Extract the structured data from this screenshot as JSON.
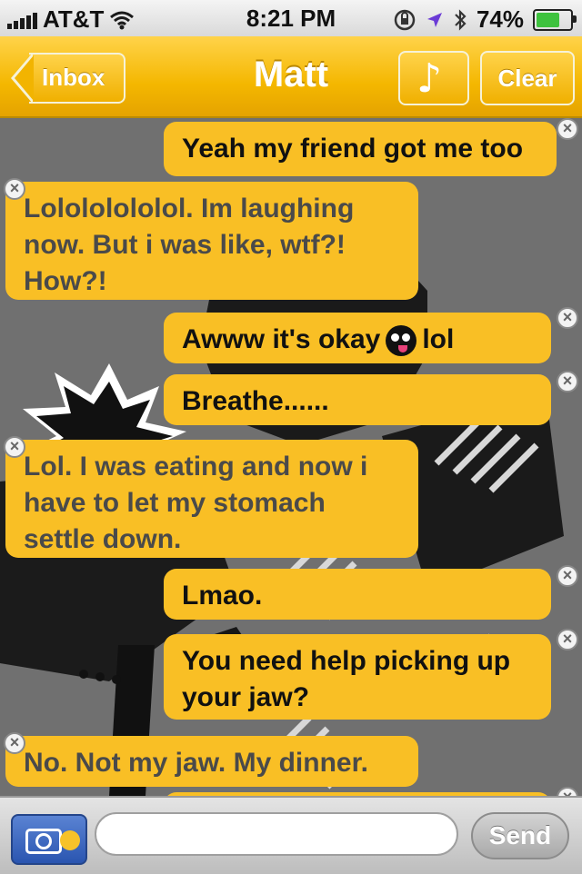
{
  "status": {
    "carrier": "AT&T",
    "time": "8:21 PM",
    "battery": "74%",
    "battery_level": 0.74
  },
  "nav": {
    "back_label": "Inbox",
    "title": "Matt",
    "music_icon": "music-note-icon",
    "clear_label": "Clear"
  },
  "messages": [
    {
      "dir": "out",
      "text": "Yeah my friend got me too"
    },
    {
      "dir": "in",
      "text": "Lolololololol. Im laughing now. But i was like, wtf?! How?!"
    },
    {
      "dir": "out",
      "text_before": "Awww it's okay",
      "emoji": "bomb-face-emoji",
      "text_after": "lol"
    },
    {
      "dir": "out",
      "text": "Breathe......"
    },
    {
      "dir": "in",
      "text": "Lol. I was eating and now i have to let my stomach settle down."
    },
    {
      "dir": "out",
      "text": "Lmao."
    },
    {
      "dir": "out",
      "text": "You need help picking up your jaw?"
    },
    {
      "dir": "in",
      "text": "No. Not my jaw. My dinner."
    }
  ],
  "input": {
    "placeholder": "",
    "send_label": "Send",
    "camera_icon": "camera-icon"
  },
  "colors": {
    "accent": "#f9bf25",
    "navbar": "#f4b700",
    "incoming_text": "#4a4a4a",
    "outgoing_text": "#111111"
  }
}
